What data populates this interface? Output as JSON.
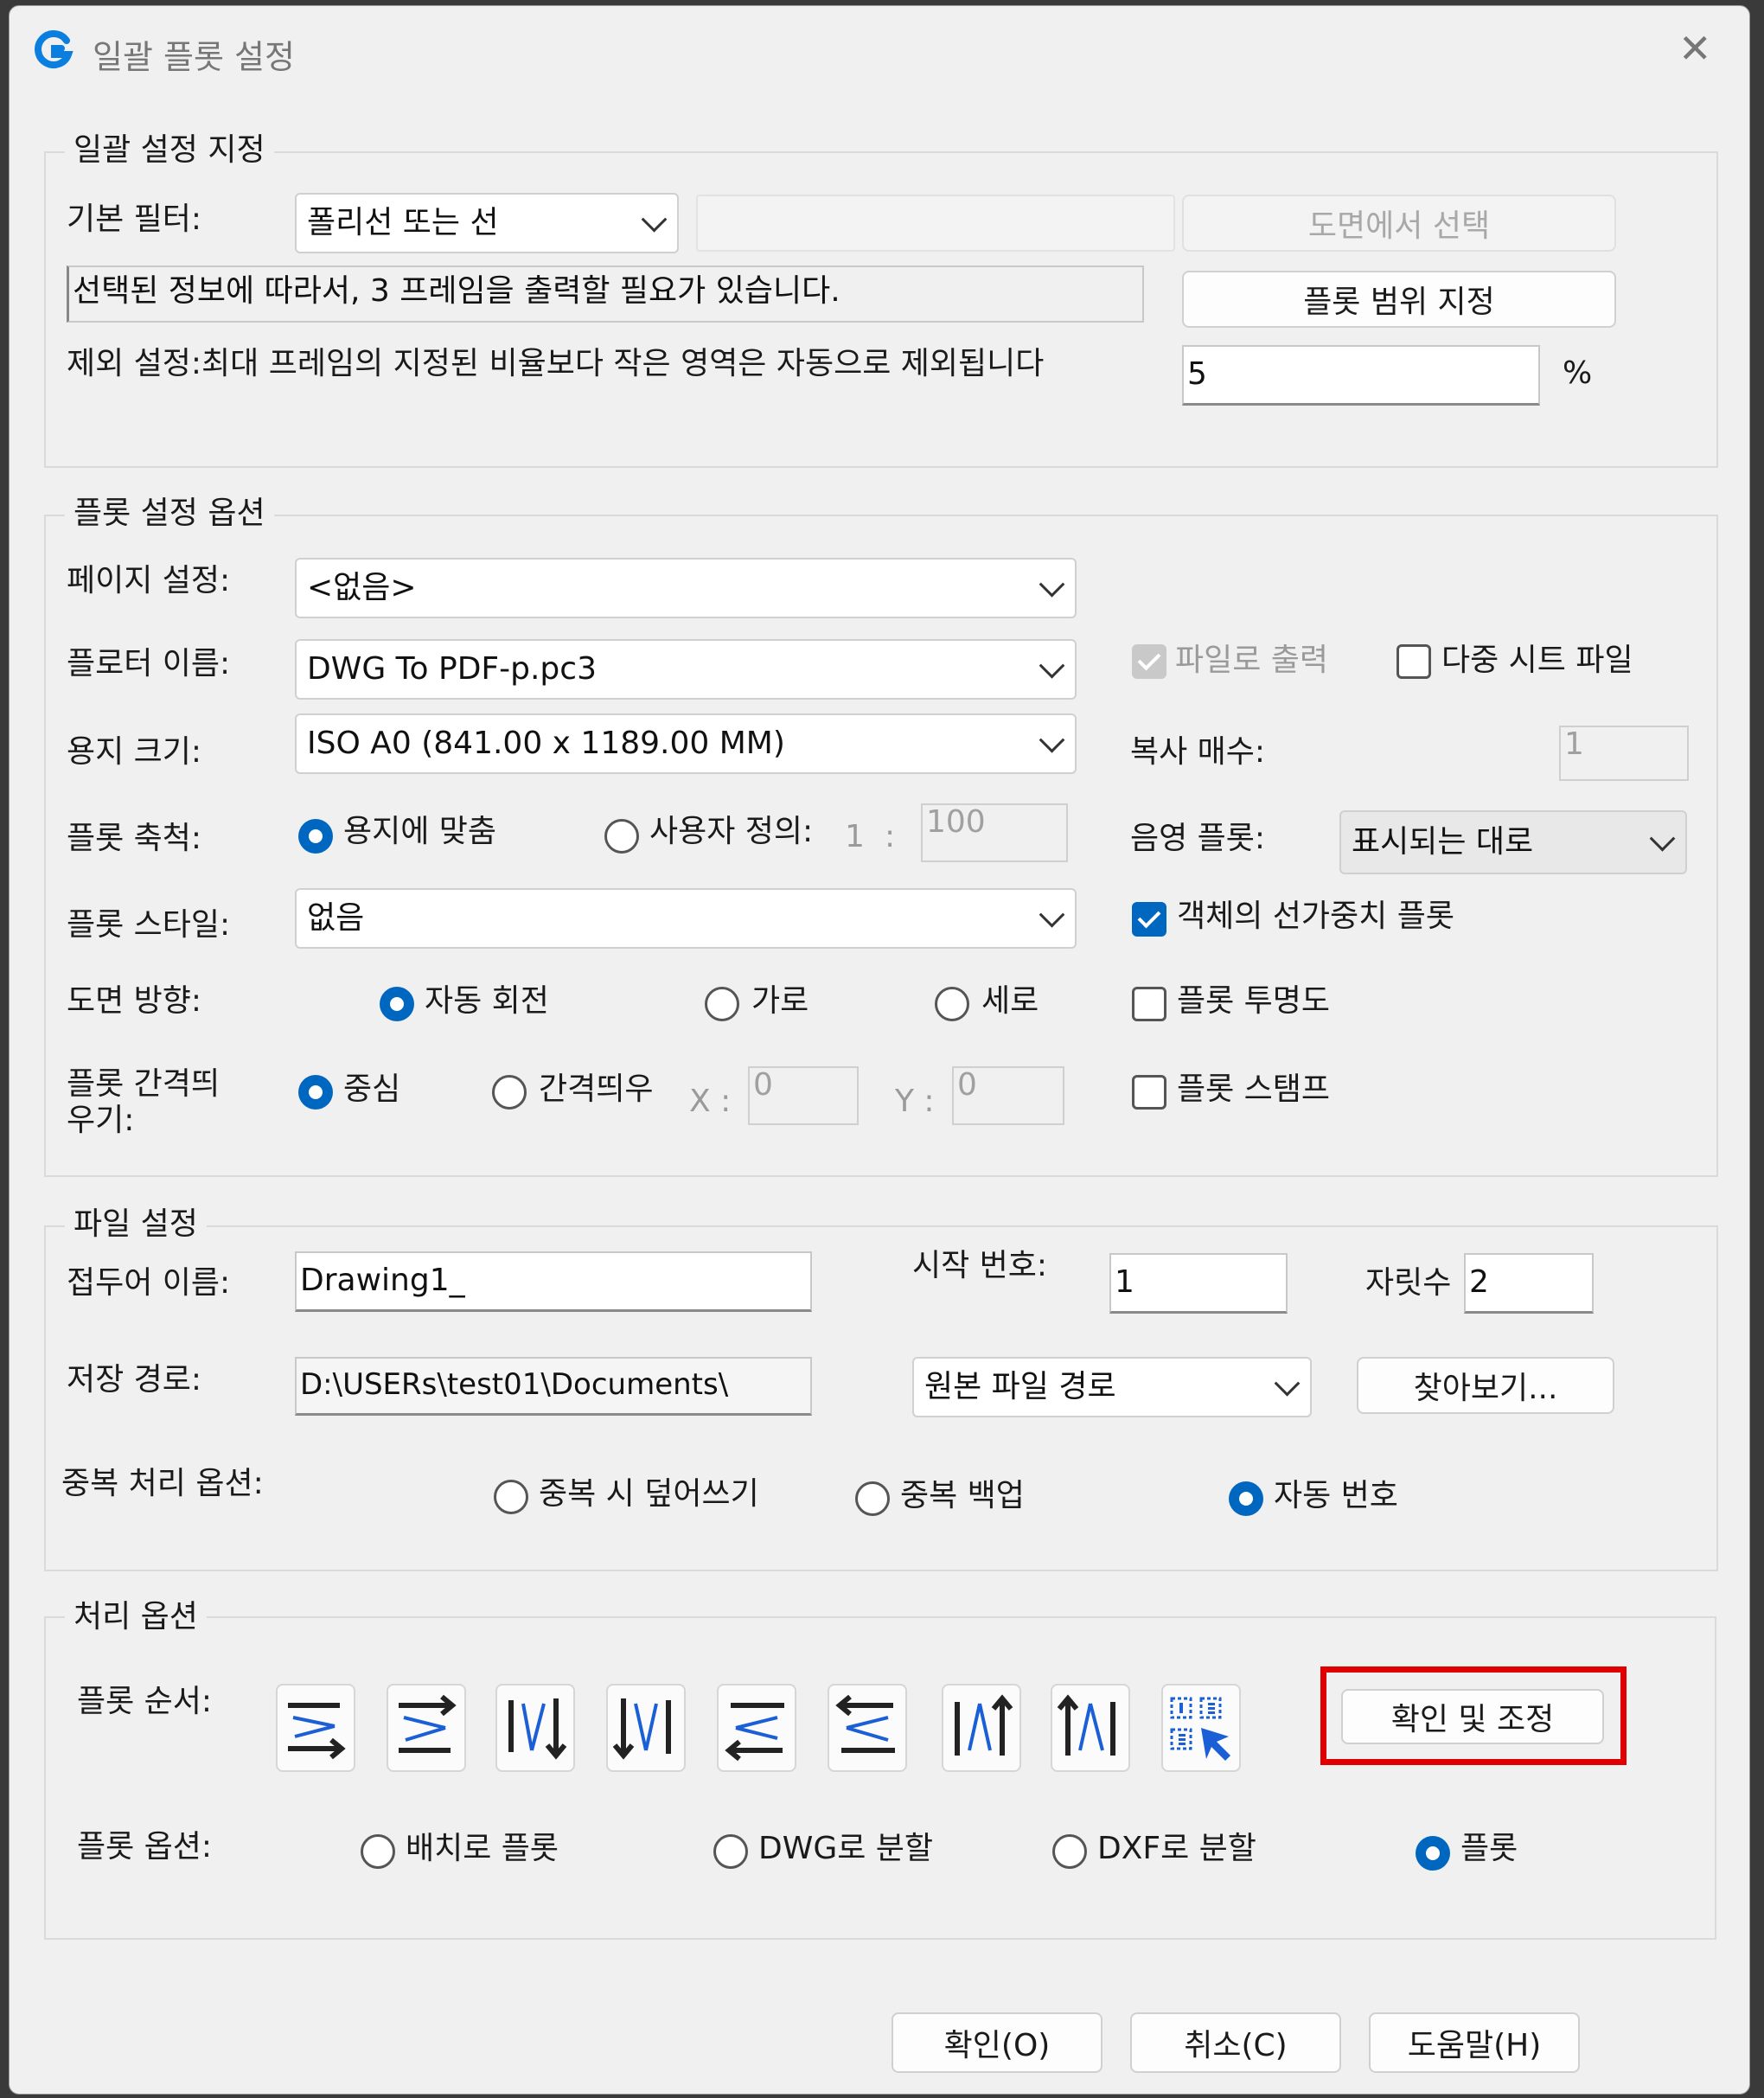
{
  "window": {
    "title": "일괄 플롯 설정",
    "close_glyph": "✕",
    "accent": "#0067c0"
  },
  "batch": {
    "group_title": "일괄 설정 지정",
    "filter_label": "기본 필터:",
    "filter_value": "폴리선 또는 선",
    "select_button": "도면에서 선택",
    "info_text": "선택된 정보에 따라서, 3 프레임을 출력할 필요가 있습니다.",
    "range_button": "플롯 범위 지정",
    "exclude_label": "제외 설정:최대 프레임의 지정된 비율보다 작은 영역은 자동으로 제외됩니다",
    "exclude_value": "5",
    "percent": "%"
  },
  "plot": {
    "group_title": "플롯 설정  옵션",
    "page_label": "페이지 설정:",
    "page_value": "<없음>",
    "plotter_label": "플로터 이름:",
    "plotter_value": "DWG To PDF-p.pc3",
    "to_file": "파일로 출력",
    "multi_sheet": "다중 시트 파일",
    "paper_label": "용지 크기:",
    "paper_value": "ISO A0 (841.00 x 1189.00 MM)",
    "copies_label": "복사 매수:",
    "copies_value": "1",
    "scale_label": "플롯 축척:",
    "fit_paper": "용지에 맞춤",
    "custom": "사용자 정의:",
    "scale_one": "1",
    "colon": ":",
    "scale_value": "100",
    "shade_label": "음영 플롯:",
    "shade_value": "표시되는 대로",
    "style_label": "플롯 스타일:",
    "style_value": "없음",
    "lineweight": "객체의 선가중치 플롯",
    "orient_label": "도면 방향:",
    "auto_rotate": "자동 회전",
    "landscape": "가로",
    "portrait": "세로",
    "transparency": "플롯 투명도",
    "offset_label": "플롯 간격띄우기:",
    "center": "중심",
    "offset": "간격띄우",
    "x_label": "X :",
    "x_value": "0",
    "y_label": "Y :",
    "y_value": "0",
    "stamp": "플롯 스탬프"
  },
  "file": {
    "group_title": "파일 설정",
    "prefix_label": "접두어 이름:",
    "prefix_value": "Drawing1_",
    "start_label": "시작 번호:",
    "start_value": "1",
    "digits_label": "자릿수",
    "digits_value": "2",
    "path_label": "저장 경로:",
    "path_value": "D:\\USERs\\test01\\Documents\\",
    "path_combo": "원본 파일 경로",
    "browse": "찾아보기...",
    "dup_label": "중복 처리 옵션:",
    "overwrite": "중복 시 덮어쓰기",
    "backup": "중복 백업",
    "auto_number": "자동 번호"
  },
  "process": {
    "group_title": "처리 옵션",
    "order_label": "플롯 순서:",
    "order_icons": [
      "rows-right-down-icon",
      "rows-right-icon",
      "columns-down-right-icon",
      "columns-down-icon",
      "rows-left-icon",
      "rows-left-down-icon",
      "columns-up-right-icon",
      "columns-up-icon",
      "manual-select-icon"
    ],
    "confirm_adjust": "확인 및 조정",
    "highlight_color": "#e00000",
    "opt_label": "플롯 옵션:",
    "layout": "배치로 플롯",
    "dwg_split": "DWG로 분할",
    "dxf_split": "DXF로 분할",
    "plot": "플롯"
  },
  "footer": {
    "ok": "확인(O)",
    "cancel": "취소(C)",
    "help": "도움말(H)"
  }
}
